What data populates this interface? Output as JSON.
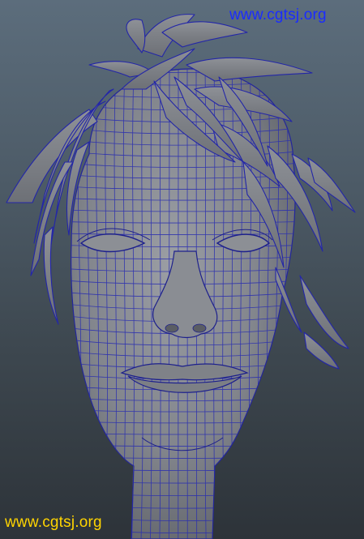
{
  "watermark": {
    "top_text": "www.cgtsj.org",
    "bottom_text": "www.cgtsj.org",
    "top_color": "#1a2cff",
    "bottom_color": "#ffd400"
  },
  "viewport": {
    "content": "wireframe-head-model",
    "background_top": "#5c6d7c",
    "background_bottom": "#2d3339",
    "shaded_color": "#8a8d93",
    "wire_color": "#2a2eb0"
  }
}
